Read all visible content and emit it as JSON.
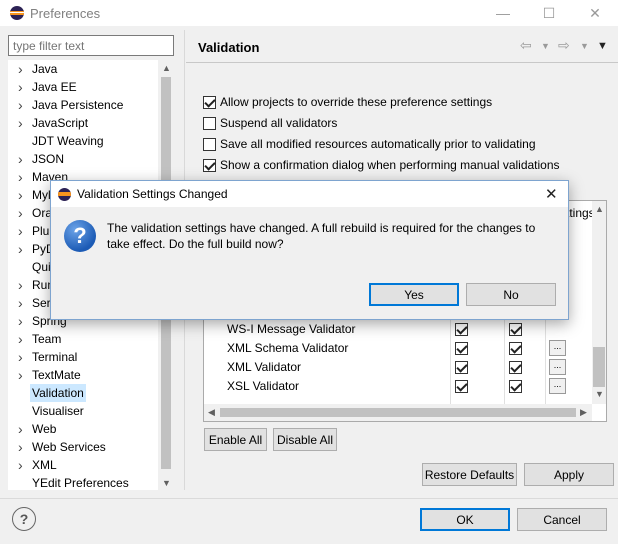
{
  "window": {
    "title": "Preferences"
  },
  "filter": {
    "placeholder": "type filter text"
  },
  "tree": {
    "items": [
      {
        "label": "Java",
        "arrow": true
      },
      {
        "label": "Java EE",
        "arrow": true
      },
      {
        "label": "Java Persistence",
        "arrow": true
      },
      {
        "label": "JavaScript",
        "arrow": true
      },
      {
        "label": "JDT Weaving",
        "arrow": false
      },
      {
        "label": "JSON",
        "arrow": true
      },
      {
        "label": "Maven",
        "arrow": true
      },
      {
        "label": "Myl",
        "arrow": true
      },
      {
        "label": "Ora",
        "arrow": true
      },
      {
        "label": "Plu",
        "arrow": true
      },
      {
        "label": "PyD",
        "arrow": true
      },
      {
        "label": "Qui",
        "arrow": false
      },
      {
        "label": "Run",
        "arrow": true
      },
      {
        "label": "Serv",
        "arrow": true
      },
      {
        "label": "Spring",
        "arrow": true
      },
      {
        "label": "Team",
        "arrow": true
      },
      {
        "label": "Terminal",
        "arrow": true
      },
      {
        "label": "TextMate",
        "arrow": true
      },
      {
        "label": "Validation",
        "arrow": false,
        "selected": true
      },
      {
        "label": "Visualiser",
        "arrow": false
      },
      {
        "label": "Web",
        "arrow": true
      },
      {
        "label": "Web Services",
        "arrow": true
      },
      {
        "label": "XML",
        "arrow": true
      },
      {
        "label": "YEdit Preferences",
        "arrow": false
      }
    ]
  },
  "page": {
    "title": "Validation",
    "options": [
      {
        "label": "Allow projects to override these preference settings",
        "checked": true
      },
      {
        "label": "Suspend all validators",
        "checked": false
      },
      {
        "label": "Save all modified resources automatically prior to validating",
        "checked": false
      },
      {
        "label": "Show a confirmation dialog when performing manual validations",
        "checked": true
      }
    ],
    "settings_partial": "ttings:",
    "validators": [
      {
        "name": "WS-I Message Validator",
        "manual": true,
        "build": true,
        "has_settings": false
      },
      {
        "name": "XML Schema Validator",
        "manual": true,
        "build": true,
        "has_settings": true
      },
      {
        "name": "XML Validator",
        "manual": true,
        "build": true,
        "has_settings": true
      },
      {
        "name": "XSL Validator",
        "manual": true,
        "build": true,
        "has_settings": true
      }
    ],
    "enable_all": "Enable All",
    "disable_all": "Disable All",
    "restore_defaults": "Restore Defaults",
    "apply": "Apply"
  },
  "footer": {
    "ok": "OK",
    "cancel": "Cancel"
  },
  "dialog": {
    "title": "Validation Settings Changed",
    "message": "The validation settings have changed. A full rebuild is required for the changes to take effect. Do the full build now?",
    "yes": "Yes",
    "no": "No"
  },
  "icons": {
    "app": "eclipse-icon",
    "question": "question-icon",
    "help": "help-icon"
  }
}
